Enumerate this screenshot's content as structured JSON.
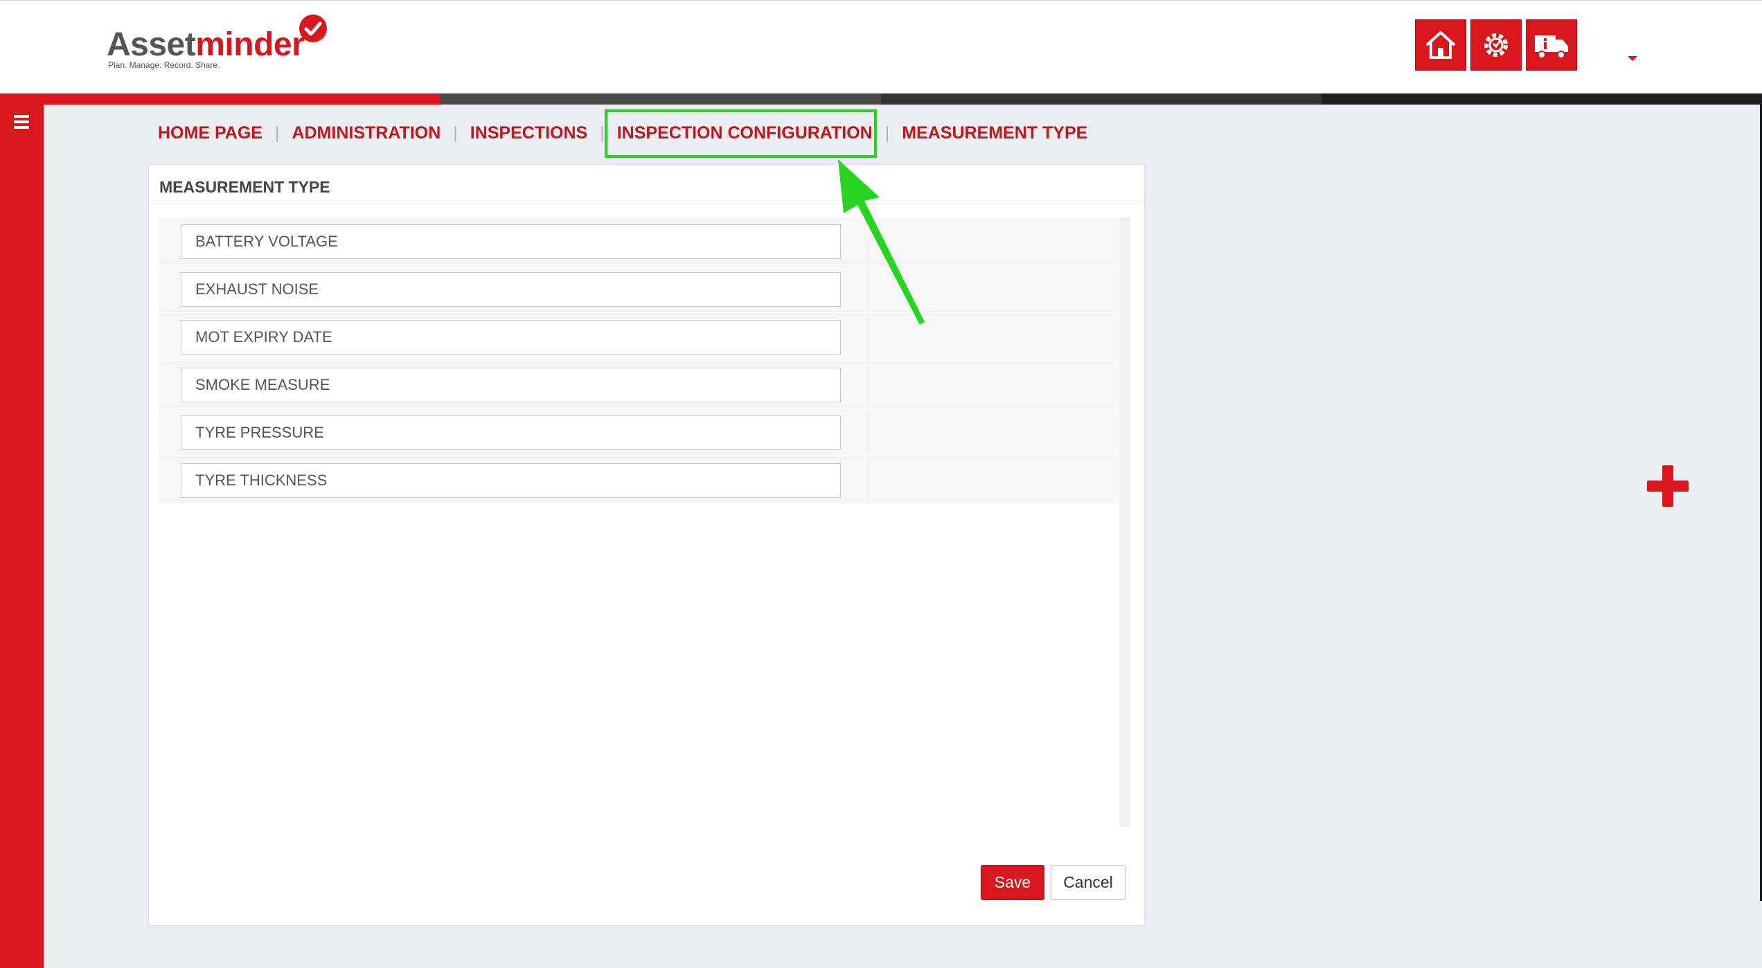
{
  "header": {
    "logo_main": "Asset",
    "logo_accent": "minder",
    "logo_tagline": "Plan. Manage. Record. Share.",
    "icons": [
      "home-icon",
      "settings-icon",
      "truck-info-icon"
    ]
  },
  "colors": {
    "brand": "#d9161c",
    "highlight": "#28d422",
    "stripe": [
      "#d9161c",
      "#4a4a4a",
      "#333333",
      "#1e1e1e"
    ]
  },
  "breadcrumb": {
    "items": [
      {
        "label": "HOME PAGE"
      },
      {
        "label": "ADMINISTRATION"
      },
      {
        "label": "INSPECTIONS"
      },
      {
        "label": "INSPECTION CONFIGURATION"
      },
      {
        "label": "MEASUREMENT TYPE"
      }
    ],
    "separator": "|"
  },
  "panel": {
    "title": "MEASUREMENT TYPE",
    "rows": [
      {
        "value": "BATTERY VOLTAGE"
      },
      {
        "value": "EXHAUST NOISE"
      },
      {
        "value": "MOT EXPIRY DATE"
      },
      {
        "value": "SMOKE MEASURE"
      },
      {
        "value": "TYRE PRESSURE"
      },
      {
        "value": "TYRE THICKNESS"
      }
    ],
    "save_label": "Save",
    "cancel_label": "Cancel"
  }
}
